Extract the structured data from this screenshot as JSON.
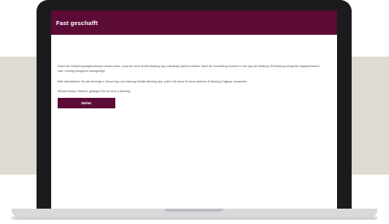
{
  "header": {
    "title": "Fast geschafft"
  },
  "content": {
    "paragraphs": [
      "Damit die Umstellung abgeschlossen werden kann, muss die neue Mobile Banking App vollständig aktiviert werden. Nach der Umstellung erscheint in der App die Meldung «Einrichtung erfolgreich abgeschlossen» oder «Vertrag erfolgreich hinzugefügt».",
      "Bitte deinstallieren Sie die bisherige e-Secure App und bisherige Mobile Banking App, sofern Sie diese für keine weiteren E-Banking Zugänge verwenden.",
      "Mit dem Button «Weiter» gelangen Sie ins neue e-Banking."
    ],
    "button_label": "Weiter"
  },
  "colors": {
    "brand": "#5c0a36",
    "backdrop": "#dddbd2",
    "laptop_frame": "#1b1b1d",
    "laptop_base": "#d8d9db"
  }
}
